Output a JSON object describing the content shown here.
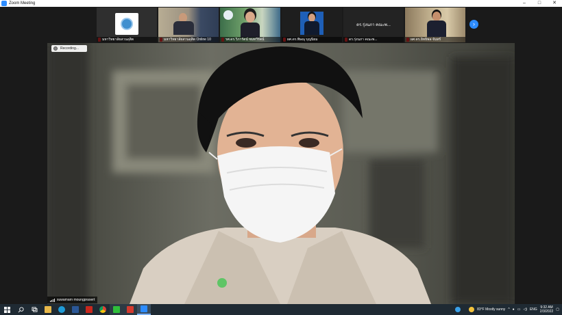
{
  "window": {
    "title": "Zoom Meeting",
    "controls": [
      "–",
      "□",
      "✕"
    ]
  },
  "gallery": {
    "participants": [
      {
        "label": "มหาวิทยาลัยสวนดุสิต"
      },
      {
        "label": "มหาวิทยาลัยสวนดุสิต Online 10"
      },
      {
        "label": "รศ.ดร.วิภารัตน์ ชมทวีรัตน์"
      },
      {
        "label": "ผศ.ดร.พิษณุ บุญนิยม"
      },
      {
        "label": "ดร.รุ่งนภา คณะพ...",
        "name_only": true
      },
      {
        "label": "ผศ.ดร.อิทธิพล จันทร์"
      }
    ],
    "next_icon": "›"
  },
  "recording": {
    "label": "Recording..."
  },
  "speaker": {
    "name": "suwamarn moungprasert"
  },
  "taskbar": {
    "weather": "83°F  Mostly sunny",
    "lang": "ENG",
    "time": "9:32 AM",
    "date": "2/3/2022"
  },
  "colors": {
    "zoom_blue": "#2d8cff",
    "mic_muted": "#e02828"
  }
}
